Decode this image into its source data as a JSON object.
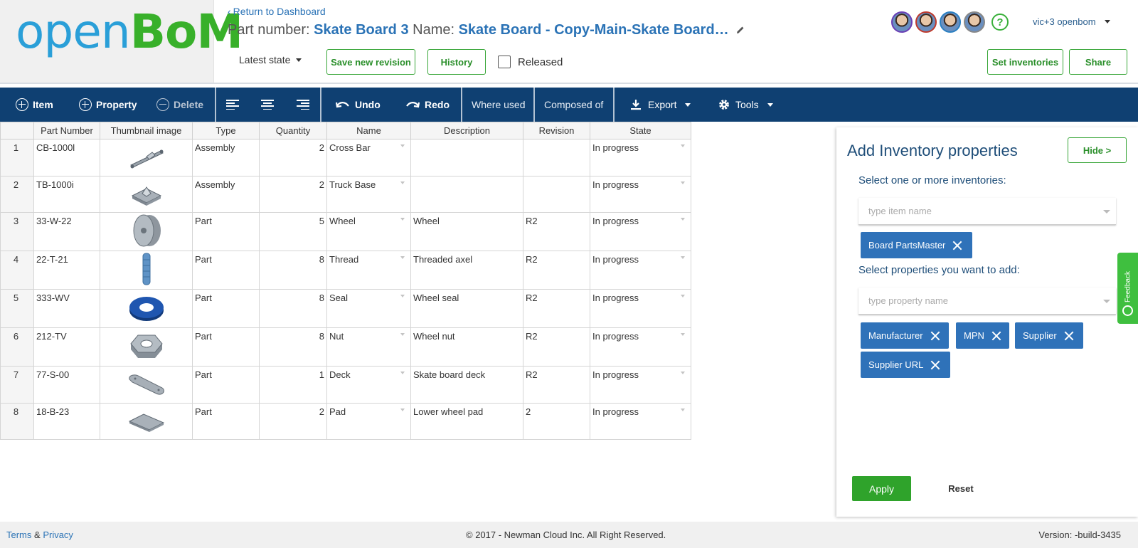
{
  "logo": {
    "part1": "open",
    "part2": "BoM"
  },
  "header": {
    "back_link": "Return to Dashboard",
    "part_number_label": "Part number:",
    "part_number": "Skate Board 3",
    "name_label": "Name:",
    "name": "Skate Board - Copy-Main-Skate Board…",
    "state_dropdown": "Latest state",
    "save_revision_label": "Save new revision",
    "history_label": "History",
    "released_label": "Released",
    "released_checked": false,
    "set_inventories_label": "Set inventories",
    "share_label": "Share",
    "help_glyph": "?",
    "user_menu": "vic+3 openbom",
    "avatar_border_colors": [
      "#6a3fb5",
      "#c0392b",
      "#2a7fc1",
      "#888888"
    ]
  },
  "toolbar": {
    "item": "Item",
    "property": "Property",
    "delete": "Delete",
    "undo": "Undo",
    "redo": "Redo",
    "where_used": "Where used",
    "composed_of": "Composed of",
    "export": "Export",
    "tools": "Tools"
  },
  "table": {
    "columns": [
      "Part Number",
      "Thumbnail image",
      "Type",
      "Quantity",
      "Name",
      "Description",
      "Revision",
      "State"
    ],
    "rows": [
      {
        "n": "1",
        "part": "CB-1000l",
        "thumb": "cross-bar",
        "type": "Assembly",
        "qty": "2",
        "name": "Cross Bar",
        "desc": "",
        "rev": "",
        "state": "In progress"
      },
      {
        "n": "2",
        "part": "TB-1000i",
        "thumb": "truck-base",
        "type": "Assembly",
        "qty": "2",
        "name": "Truck Base",
        "desc": "",
        "rev": "",
        "state": "In progress"
      },
      {
        "n": "3",
        "part": "33-W-22",
        "thumb": "wheel",
        "type": "Part",
        "qty": "5",
        "name": "Wheel",
        "desc": "Wheel",
        "rev": "R2",
        "state": "In progress"
      },
      {
        "n": "4",
        "part": "22-T-21",
        "thumb": "thread",
        "type": "Part",
        "qty": "8",
        "name": "Thread",
        "desc": "Threaded axel",
        "rev": "R2",
        "state": "In progress"
      },
      {
        "n": "5",
        "part": "333-WV",
        "thumb": "seal",
        "type": "Part",
        "qty": "8",
        "name": "Seal",
        "desc": "Wheel seal",
        "rev": "R2",
        "state": "In progress"
      },
      {
        "n": "6",
        "part": "212-TV",
        "thumb": "nut",
        "type": "Part",
        "qty": "8",
        "name": "Nut",
        "desc": "Wheel nut",
        "rev": "R2",
        "state": "In progress"
      },
      {
        "n": "7",
        "part": "77-S-00",
        "thumb": "deck",
        "type": "Part",
        "qty": "1",
        "name": "Deck",
        "desc": "Skate board deck",
        "rev": "R2",
        "state": "In progress"
      },
      {
        "n": "8",
        "part": "18-B-23",
        "thumb": "pad",
        "type": "Part",
        "qty": "2",
        "name": "Pad",
        "desc": "Lower wheel pad",
        "rev": "2",
        "state": "In progress"
      }
    ]
  },
  "panel": {
    "title": "Add Inventory properties",
    "hide_label": "Hide >",
    "inventories_label": "Select one or more inventories:",
    "inventories_placeholder": "type item name",
    "inventories_selected": [
      "Board PartsMaster"
    ],
    "properties_label": "Select properties you want to add:",
    "properties_placeholder": "type property name",
    "properties_selected": [
      "Manufacturer",
      "MPN",
      "Supplier",
      "Supplier URL"
    ],
    "apply_label": "Apply",
    "reset_label": "Reset"
  },
  "feedback_label": "Feedback",
  "footer": {
    "terms": "Terms",
    "amp": "&",
    "privacy": "Privacy",
    "copyright": "© 2017 - Newman Cloud Inc. All Right Reserved.",
    "version": "Version: -build-3435"
  },
  "colors": {
    "toolbar_bg": "#0f4072",
    "accent_green": "#2fa32b",
    "tag_blue": "#2f72b9",
    "link_blue": "#2b73b6"
  }
}
